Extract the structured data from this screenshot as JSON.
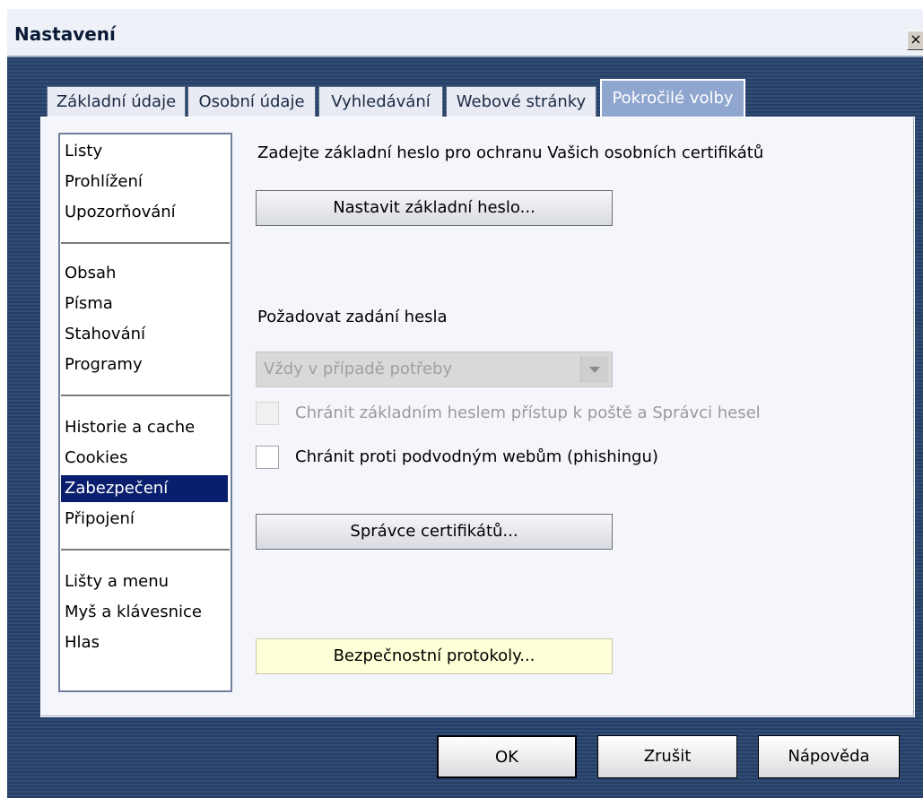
{
  "window": {
    "title": "Nastavení",
    "close_glyph": "×"
  },
  "tabs": [
    {
      "label": "Základní údaje"
    },
    {
      "label": "Osobní údaje"
    },
    {
      "label": "Vyhledávání"
    },
    {
      "label": "Webové stránky"
    },
    {
      "label": "Pokročilé volby",
      "active": true
    }
  ],
  "sidebar": {
    "groups": [
      [
        "Listy",
        "Prohlížení",
        "Upozorňování"
      ],
      [
        "Obsah",
        "Písma",
        "Stahování",
        "Programy"
      ],
      [
        "Historie a cache",
        "Cookies",
        "Zabezpečení",
        "Připojení"
      ],
      [
        "Lišty a menu",
        "Myš a klávesnice",
        "Hlas"
      ]
    ],
    "selected": "Zabezpečení"
  },
  "security": {
    "master_password_text": "Zadejte základní heslo pro ochranu Vašich osobních certifikátů",
    "set_master_password_button": "Nastavit základní heslo...",
    "ask_password_label": "Požadovat zadání hesla",
    "ask_password_select": {
      "value": "Vždy v případě potřeby",
      "disabled": true
    },
    "protect_mail_checkbox": {
      "label": "Chránit základním heslem přístup k poště a Správci hesel",
      "checked": false,
      "disabled": true
    },
    "phishing_checkbox": {
      "label": "Chránit proti podvodným webům (phishingu)",
      "checked": false
    },
    "cert_manager_button": "Správce certifikátů...",
    "security_protocols_button": "Bezpečnostní protokoly..."
  },
  "footer": {
    "ok": "OK",
    "cancel": "Zrušit",
    "help": "Nápověda"
  },
  "colors": {
    "selection": "#0a1e6e",
    "active_tab": "#8fa6cf",
    "dialog_frame": "#27436e",
    "highlight_button": "#ffffd8"
  }
}
